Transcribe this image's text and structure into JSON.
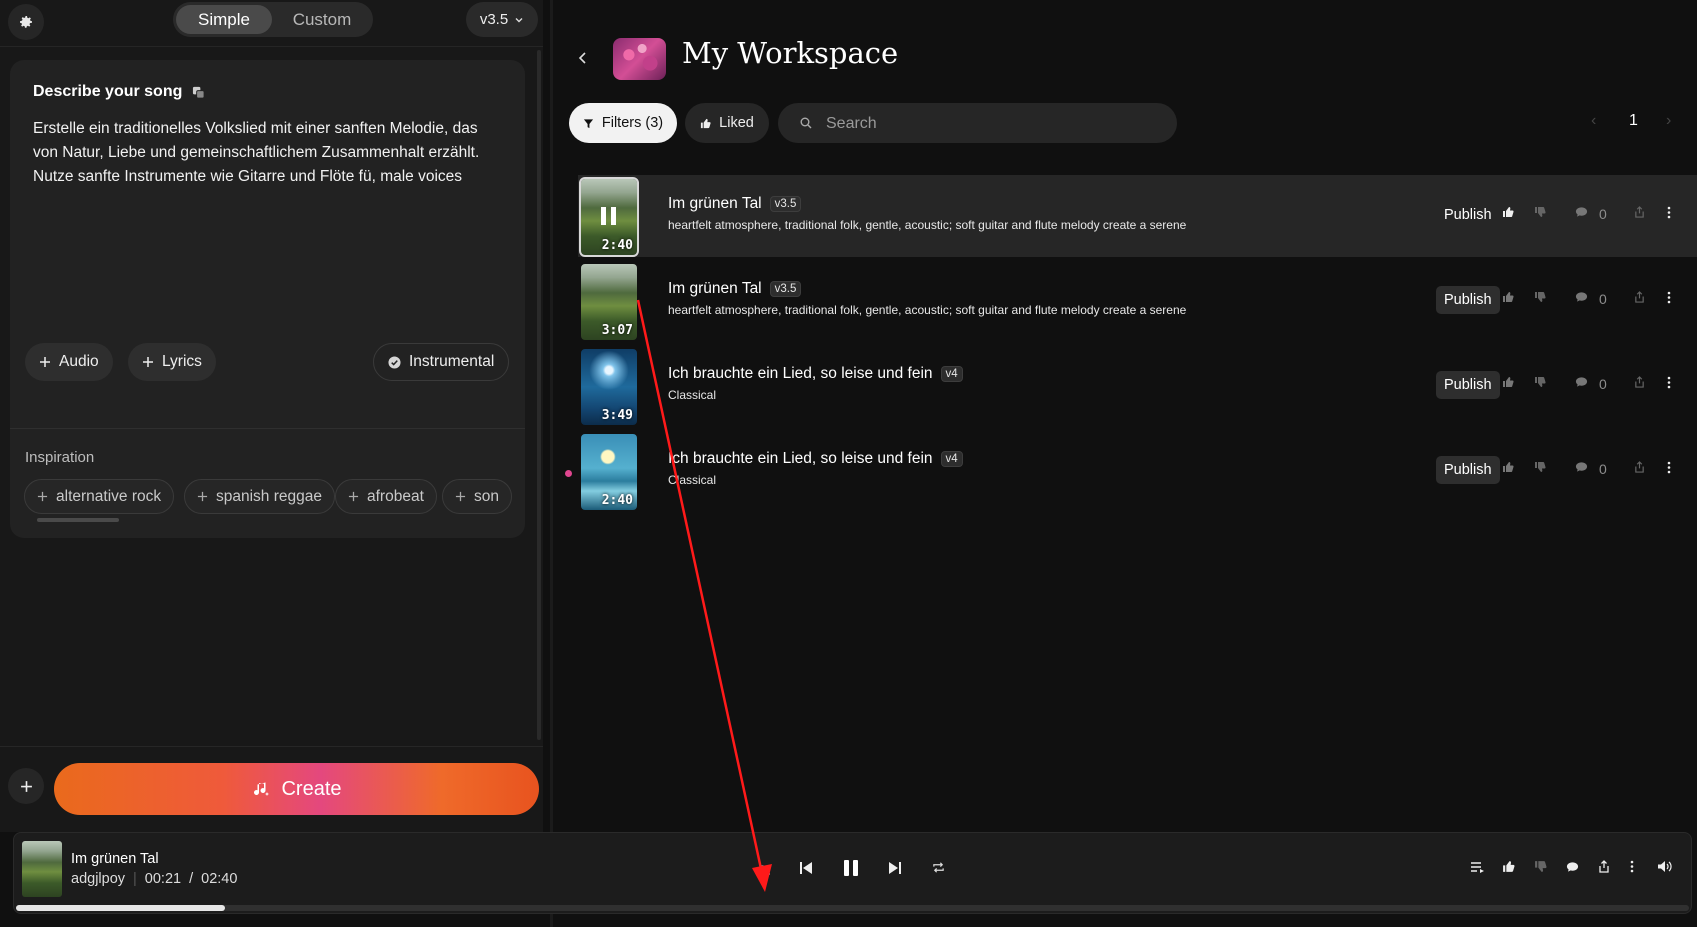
{
  "header": {
    "mode_tabs": [
      "Simple",
      "Custom"
    ],
    "version": "v3.5"
  },
  "describe": {
    "title": "Describe your song",
    "prompt": "Erstelle ein traditionelles Volkslied mit einer sanften Melodie, das von Natur, Liebe und gemeinschaftlichem Zusammenhalt erzählt. Nutze sanfte Instrumente wie Gitarre und Flöte fü, male voices",
    "audio_label": "Audio",
    "lyrics_label": "Lyrics",
    "instrumental_label": "Instrumental"
  },
  "inspiration": {
    "label": "Inspiration",
    "tags": [
      "alternative rock",
      "spanish reggae",
      "afrobeat",
      "son"
    ]
  },
  "create_label": "Create",
  "workspace": {
    "title": "My Workspace",
    "filters_label": "Filters (3)",
    "liked_label": "Liked",
    "search_placeholder": "Search",
    "page": "1"
  },
  "songs": [
    {
      "title": "Im grünen Tal",
      "version": "v3.5",
      "desc": "heartfelt atmosphere, traditional folk, gentle, acoustic; soft guitar and flute melody create a serene",
      "duration": "2:40",
      "publish": "Publish",
      "comments": "0",
      "thumb": "valley",
      "playing": true
    },
    {
      "title": "Im grünen Tal",
      "version": "v3.5",
      "desc": "heartfelt atmosphere, traditional folk, gentle, acoustic; soft guitar and flute melody create a serene",
      "duration": "3:07",
      "publish": "Publish",
      "comments": "0",
      "thumb": "valley",
      "playing": false
    },
    {
      "title": "Ich brauchte ein Lied, so leise und fein",
      "version": "v4",
      "desc": "Classical",
      "duration": "3:49",
      "publish": "Publish",
      "comments": "0",
      "thumb": "night",
      "playing": false
    },
    {
      "title": "Ich brauchte ein Lied, so leise und fein",
      "version": "v4",
      "desc": "Classical",
      "duration": "2:40",
      "publish": "Publish",
      "comments": "0",
      "thumb": "lake",
      "playing": false,
      "unread": true
    }
  ],
  "player": {
    "title": "Im grünen Tal",
    "artist": "adgjlpoy",
    "current": "00:21",
    "separator": "/",
    "total": "02:40",
    "progress_fraction": 0.125
  },
  "colors": {
    "accent_orange": "#ea6a1c",
    "accent_pink": "#e4487e",
    "annotation_red": "#ff1a1a",
    "unread_dot": "#e0468f"
  }
}
